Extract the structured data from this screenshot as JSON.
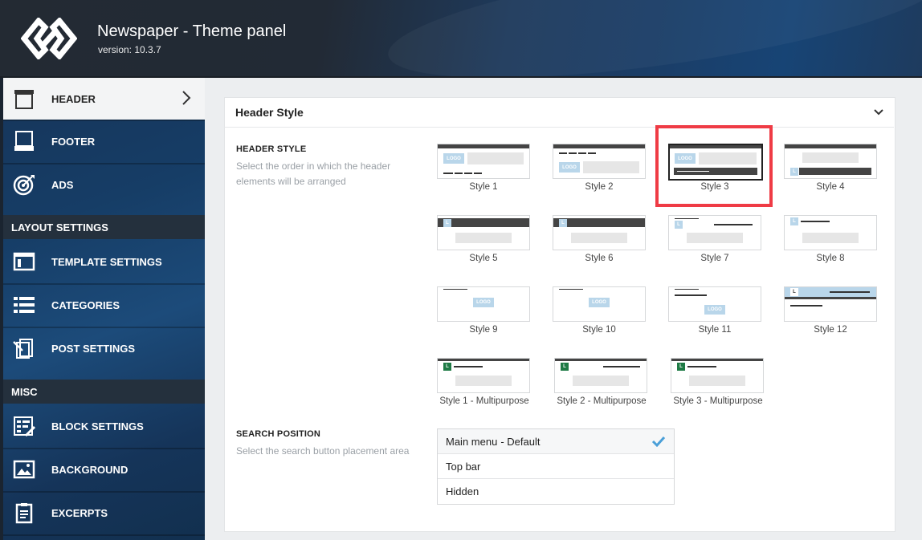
{
  "app": {
    "title": "Newspaper - Theme panel",
    "version": "version: 10.3.7"
  },
  "sidebar": {
    "items": [
      {
        "label": "HEADER",
        "icon": "header-icon",
        "active": true
      },
      {
        "label": "FOOTER",
        "icon": "footer-icon"
      },
      {
        "label": "ADS",
        "icon": "target-icon"
      },
      {
        "label": "TEMPLATE SETTINGS",
        "icon": "template-icon"
      },
      {
        "label": "CATEGORIES",
        "icon": "list-icon"
      },
      {
        "label": "POST SETTINGS",
        "icon": "post-settings-icon"
      },
      {
        "label": "BLOCK SETTINGS",
        "icon": "block-settings-icon"
      },
      {
        "label": "BACKGROUND",
        "icon": "image-icon"
      },
      {
        "label": "EXCERPTS",
        "icon": "clipboard-icon"
      }
    ],
    "sections": {
      "layout": "LAYOUT SETTINGS",
      "misc": "MISC"
    }
  },
  "panel": {
    "title": "Header Style",
    "header_style": {
      "label": "HEADER STYLE",
      "description": "Select the order in which the header elements will be arranged",
      "selected": "Style 3",
      "styles": [
        "Style 1",
        "Style 2",
        "Style 3",
        "Style 4",
        "Style 5",
        "Style 6",
        "Style 7",
        "Style 8",
        "Style 9",
        "Style 10",
        "Style 11",
        "Style 12",
        "Style 1 - Multipurpose",
        "Style 2 - Multipurpose",
        "Style 3 - Multipurpose"
      ],
      "logo_text": "LOGO",
      "l_text": "L"
    },
    "search_position": {
      "label": "SEARCH POSITION",
      "description": "Select the search button placement area",
      "options": [
        {
          "label": "Main menu",
          "suffix": "- Default",
          "selected": true
        },
        {
          "label": "Top bar",
          "suffix": ""
        },
        {
          "label": "Hidden",
          "suffix": ""
        }
      ]
    }
  },
  "colors": {
    "accent": "#4a9fd8",
    "highlight": "#ef3b45",
    "logo_box": "#b9d6ea",
    "green_logo": "#1e7a45"
  }
}
